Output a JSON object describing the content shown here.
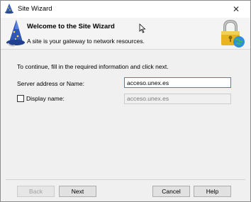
{
  "window": {
    "title": "Site Wizard",
    "close_glyph": "✕"
  },
  "header": {
    "title": "Welcome to the Site Wizard",
    "subtitle": "A site is your gateway to network resources.",
    "left_icon": "wizard-hat-icon",
    "right_icon": "padlock-globe-icon"
  },
  "form": {
    "instructions": "To continue, fill in the required information and click next.",
    "server_label": "Server address or Name:",
    "server_value": "acceso.unex.es",
    "display_checkbox_checked": false,
    "display_label": "Display name:",
    "display_value": "acceso.unex.es"
  },
  "buttons": {
    "back": "Back",
    "next": "Next",
    "cancel": "Cancel",
    "help": "Help"
  },
  "colors": {
    "focus_border": "#4a7fc1",
    "dialog_bg": "#f0f0f0"
  }
}
